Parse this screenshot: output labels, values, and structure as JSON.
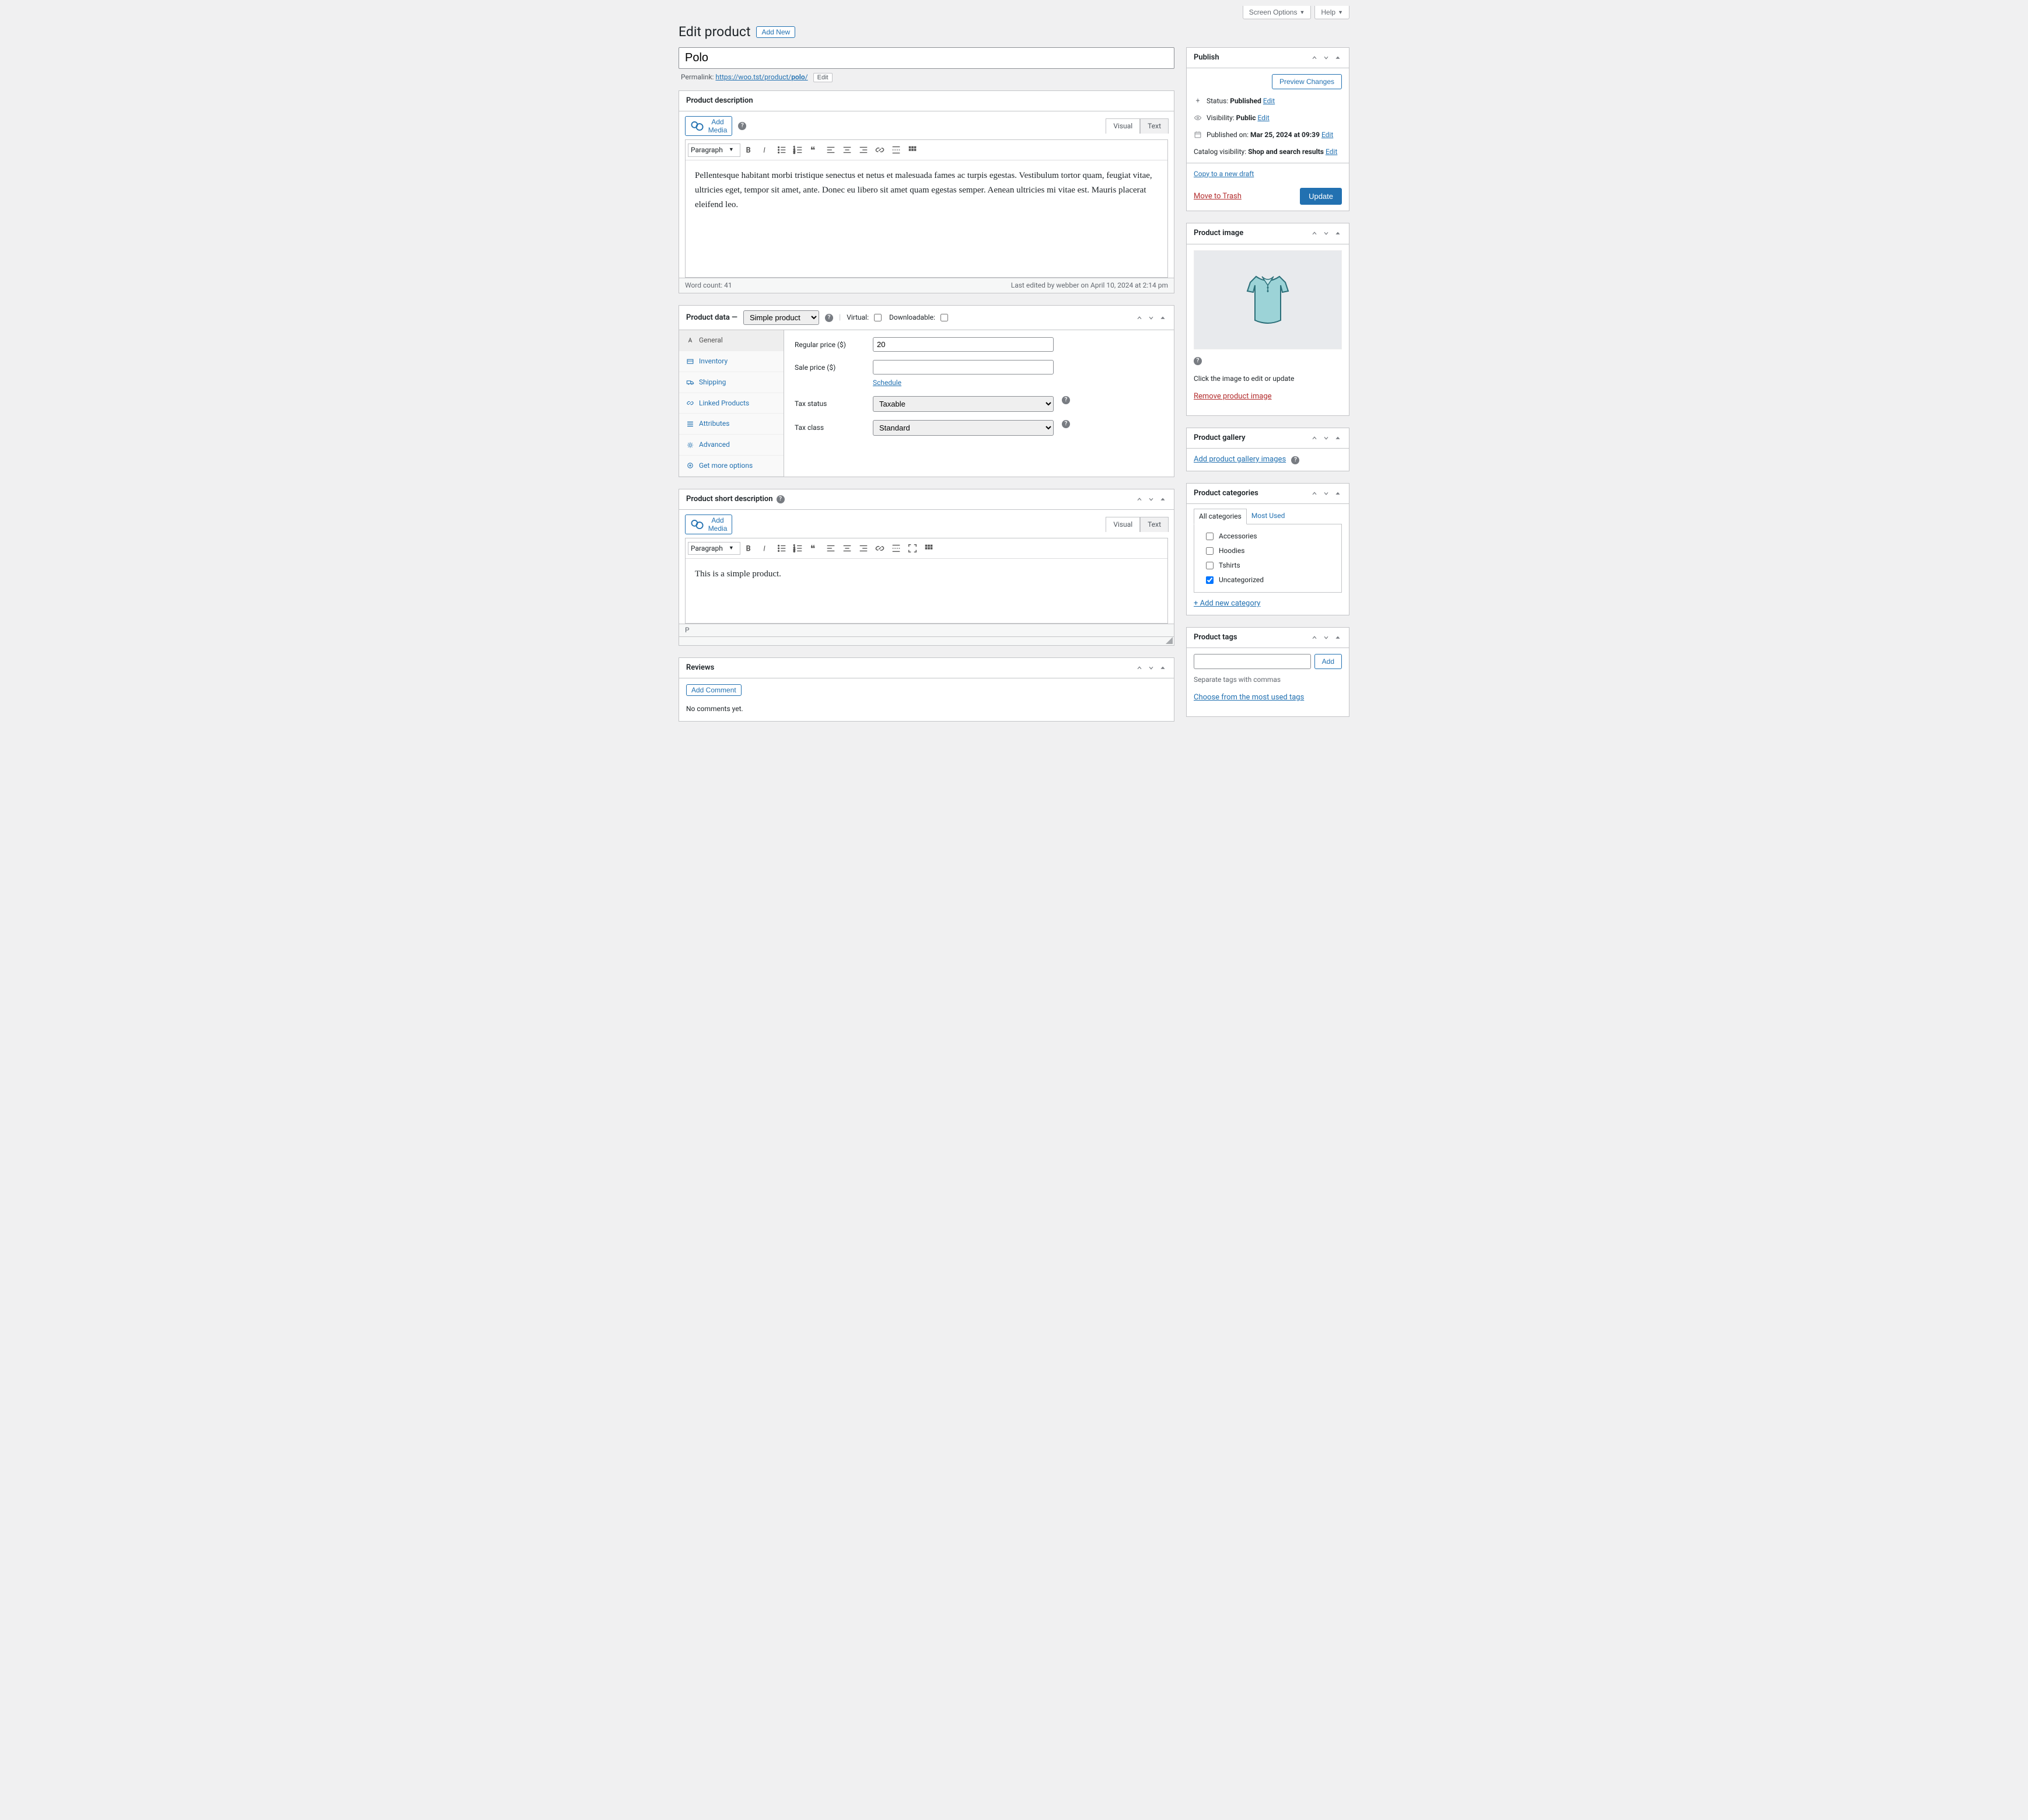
{
  "screenMeta": {
    "options": "Screen Options",
    "help": "Help"
  },
  "header": {
    "title": "Edit product",
    "addNew": "Add New"
  },
  "product": {
    "title": "Polo",
    "permalinkLabel": "Permalink:",
    "permalinkBase": "https://woo.tst/product/",
    "permalinkSlug": "polo",
    "permalinkTrail": "/",
    "edit": "Edit"
  },
  "desc": {
    "panelTitle": "Product description",
    "addMedia": "Add Media",
    "visual": "Visual",
    "text": "Text",
    "paragraph": "Paragraph",
    "body": "Pellentesque habitant morbi tristique senectus et netus et malesuada fames ac turpis egestas. Vestibulum tortor quam, feugiat vitae, ultricies eget, tempor sit amet, ante. Donec eu libero sit amet quam egestas semper. Aenean ultricies mi vitae est. Mauris placerat eleifend leo.",
    "wordCountLabel": "Word count: 41",
    "lastEdited": "Last edited by webber on April 10, 2024 at 2:14 pm"
  },
  "productData": {
    "panelTitle": "Product data —",
    "typeSelected": "Simple product",
    "virtualLabel": "Virtual:",
    "downloadableLabel": "Downloadable:",
    "tabs": [
      {
        "key": "general",
        "label": "General"
      },
      {
        "key": "inventory",
        "label": "Inventory"
      },
      {
        "key": "shipping",
        "label": "Shipping"
      },
      {
        "key": "linked",
        "label": "Linked Products"
      },
      {
        "key": "attributes",
        "label": "Attributes"
      },
      {
        "key": "advanced",
        "label": "Advanced"
      },
      {
        "key": "more",
        "label": "Get more options"
      }
    ],
    "fields": {
      "regularPriceLabel": "Regular price ($)",
      "regularPrice": "20",
      "salePriceLabel": "Sale price ($)",
      "salePrice": "",
      "schedule": "Schedule",
      "taxStatusLabel": "Tax status",
      "taxStatus": "Taxable",
      "taxClassLabel": "Tax class",
      "taxClass": "Standard"
    }
  },
  "shortDesc": {
    "panelTitle": "Product short description",
    "body": "This is a simple product.",
    "path": "P"
  },
  "reviews": {
    "panelTitle": "Reviews",
    "addComment": "Add Comment",
    "empty": "No comments yet."
  },
  "publish": {
    "panelTitle": "Publish",
    "preview": "Preview Changes",
    "update": "Update",
    "statusLabel": "Status:",
    "statusValue": "Published",
    "visibilityLabel": "Visibility:",
    "visibilityValue": "Public",
    "publishedOnLabel": "Published on:",
    "publishedOnValue": "Mar 25, 2024 at 09:39",
    "catalogLabel": "Catalog visibility:",
    "catalogValue": "Shop and search results",
    "edit": "Edit",
    "copyDraft": "Copy to a new draft",
    "moveTrash": "Move to Trash"
  },
  "image": {
    "panelTitle": "Product image",
    "hint": "Click the image to edit or update",
    "remove": "Remove product image"
  },
  "gallery": {
    "panelTitle": "Product gallery",
    "add": "Add product gallery images"
  },
  "categories": {
    "panelTitle": "Product categories",
    "tabAll": "All categories",
    "tabMost": "Most Used",
    "items": [
      {
        "label": "Accessories",
        "checked": false
      },
      {
        "label": "Hoodies",
        "checked": false
      },
      {
        "label": "Tshirts",
        "checked": false
      },
      {
        "label": "Uncategorized",
        "checked": true
      }
    ],
    "addNew": "+ Add new category"
  },
  "tags": {
    "panelTitle": "Product tags",
    "add": "Add",
    "hint": "Separate tags with commas",
    "choose": "Choose from the most used tags"
  }
}
